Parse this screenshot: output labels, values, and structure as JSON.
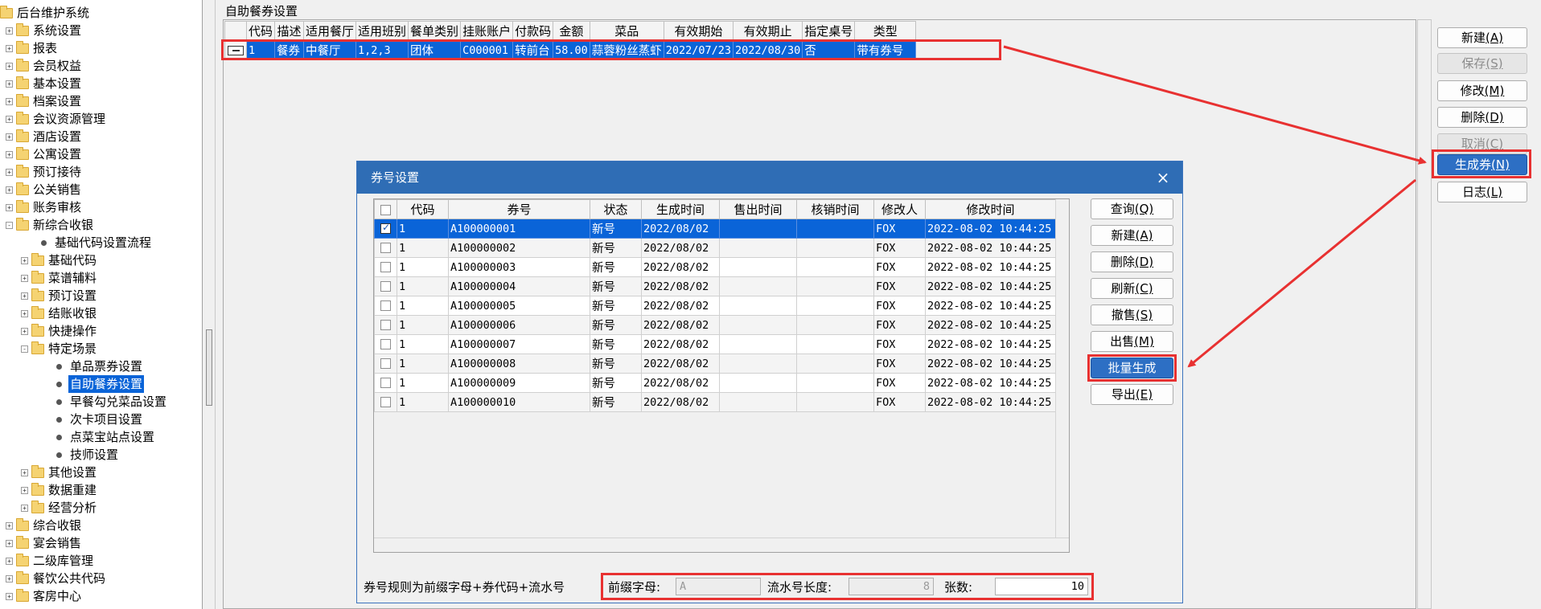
{
  "tree": {
    "items": [
      {
        "label": "后台维护系统",
        "level": 0,
        "kind": "folder",
        "toggle": ""
      },
      {
        "label": "系统设置",
        "level": 1,
        "kind": "folder",
        "toggle": "+"
      },
      {
        "label": "报表",
        "level": 1,
        "kind": "folder",
        "toggle": "+"
      },
      {
        "label": "会员权益",
        "level": 1,
        "kind": "folder",
        "toggle": "+"
      },
      {
        "label": "基本设置",
        "level": 1,
        "kind": "folder",
        "toggle": "+"
      },
      {
        "label": "档案设置",
        "level": 1,
        "kind": "folder",
        "toggle": "+"
      },
      {
        "label": "会议资源管理",
        "level": 1,
        "kind": "folder",
        "toggle": "+"
      },
      {
        "label": "酒店设置",
        "level": 1,
        "kind": "folder",
        "toggle": "+"
      },
      {
        "label": "公寓设置",
        "level": 1,
        "kind": "folder",
        "toggle": "+"
      },
      {
        "label": "预订接待",
        "level": 1,
        "kind": "folder",
        "toggle": "+"
      },
      {
        "label": "公关销售",
        "level": 1,
        "kind": "folder",
        "toggle": "+"
      },
      {
        "label": "账务审核",
        "level": 1,
        "kind": "folder",
        "toggle": "+"
      },
      {
        "label": "新综合收银",
        "level": 1,
        "kind": "folder",
        "toggle": "-"
      },
      {
        "label": "基础代码设置流程",
        "level": 2,
        "kind": "leaf",
        "toggle": ""
      },
      {
        "label": "基础代码",
        "level": 2,
        "kind": "folder",
        "toggle": "+"
      },
      {
        "label": "菜谱辅料",
        "level": 2,
        "kind": "folder",
        "toggle": "+"
      },
      {
        "label": "预订设置",
        "level": 2,
        "kind": "folder",
        "toggle": "+"
      },
      {
        "label": "结账收银",
        "level": 2,
        "kind": "folder",
        "toggle": "+"
      },
      {
        "label": "快捷操作",
        "level": 2,
        "kind": "folder",
        "toggle": "+"
      },
      {
        "label": "特定场景",
        "level": 2,
        "kind": "folder",
        "toggle": "-"
      },
      {
        "label": "单品票券设置",
        "level": 3,
        "kind": "leaf",
        "toggle": ""
      },
      {
        "label": "自助餐券设置",
        "level": 3,
        "kind": "leaf",
        "toggle": "",
        "selected": true
      },
      {
        "label": "早餐勾兑菜品设置",
        "level": 3,
        "kind": "leaf",
        "toggle": ""
      },
      {
        "label": "次卡项目设置",
        "level": 3,
        "kind": "leaf",
        "toggle": ""
      },
      {
        "label": "点菜宝站点设置",
        "level": 3,
        "kind": "leaf",
        "toggle": ""
      },
      {
        "label": "技师设置",
        "level": 3,
        "kind": "leaf",
        "toggle": ""
      },
      {
        "label": "其他设置",
        "level": 2,
        "kind": "folder",
        "toggle": "+"
      },
      {
        "label": "数据重建",
        "level": 2,
        "kind": "folder",
        "toggle": "+"
      },
      {
        "label": "经营分析",
        "level": 2,
        "kind": "folder",
        "toggle": "+"
      },
      {
        "label": "综合收银",
        "level": 1,
        "kind": "folder",
        "toggle": "+"
      },
      {
        "label": "宴会销售",
        "level": 1,
        "kind": "folder",
        "toggle": "+"
      },
      {
        "label": "二级库管理",
        "level": 1,
        "kind": "folder",
        "toggle": "+"
      },
      {
        "label": "餐饮公共代码",
        "level": 1,
        "kind": "folder",
        "toggle": "+"
      },
      {
        "label": "客房中心",
        "level": 1,
        "kind": "folder",
        "toggle": "+"
      }
    ]
  },
  "main": {
    "title": "自助餐券设置",
    "columns": [
      "代码",
      "描述",
      "适用餐厅",
      "适用班别",
      "餐单类别",
      "挂账账户",
      "付款码",
      "金额",
      "菜品",
      "有效期始",
      "有效期止",
      "指定桌号",
      "类型"
    ],
    "rows": [
      [
        "1",
        "餐券",
        "中餐厅",
        "1,2,3",
        "团体",
        "C000001",
        "转前台",
        "58.00",
        "蒜蓉粉丝蒸虾",
        "2022/07/23",
        "2022/08/30",
        "否",
        "带有券号"
      ]
    ]
  },
  "side_buttons": [
    {
      "label": "新建",
      "key": "(A)",
      "state": "normal"
    },
    {
      "label": "保存",
      "key": "(S)",
      "state": "disabled"
    },
    {
      "label": "修改",
      "key": "(M)",
      "state": "normal"
    },
    {
      "label": "删除",
      "key": "(D)",
      "state": "normal"
    },
    {
      "label": "取消",
      "key": "(C)",
      "state": "disabled"
    },
    {
      "label": "生成券",
      "key": "(N)",
      "state": "active"
    },
    {
      "label": "日志",
      "key": "(L)",
      "state": "normal"
    }
  ],
  "dialog": {
    "title": "券号设置",
    "close": "×",
    "columns": [
      "",
      "代码",
      "券号",
      "状态",
      "生成时间",
      "售出时间",
      "核销时间",
      "修改人",
      "修改时间"
    ],
    "rows": [
      {
        "checked": true,
        "cells": [
          "1",
          "A100000001",
          "新号",
          "2022/08/02",
          "",
          "",
          "FOX",
          "2022-08-02 10:44:25"
        ]
      },
      {
        "checked": false,
        "cells": [
          "1",
          "A100000002",
          "新号",
          "2022/08/02",
          "",
          "",
          "FOX",
          "2022-08-02 10:44:25"
        ]
      },
      {
        "checked": false,
        "cells": [
          "1",
          "A100000003",
          "新号",
          "2022/08/02",
          "",
          "",
          "FOX",
          "2022-08-02 10:44:25"
        ]
      },
      {
        "checked": false,
        "cells": [
          "1",
          "A100000004",
          "新号",
          "2022/08/02",
          "",
          "",
          "FOX",
          "2022-08-02 10:44:25"
        ]
      },
      {
        "checked": false,
        "cells": [
          "1",
          "A100000005",
          "新号",
          "2022/08/02",
          "",
          "",
          "FOX",
          "2022-08-02 10:44:25"
        ]
      },
      {
        "checked": false,
        "cells": [
          "1",
          "A100000006",
          "新号",
          "2022/08/02",
          "",
          "",
          "FOX",
          "2022-08-02 10:44:25"
        ]
      },
      {
        "checked": false,
        "cells": [
          "1",
          "A100000007",
          "新号",
          "2022/08/02",
          "",
          "",
          "FOX",
          "2022-08-02 10:44:25"
        ]
      },
      {
        "checked": false,
        "cells": [
          "1",
          "A100000008",
          "新号",
          "2022/08/02",
          "",
          "",
          "FOX",
          "2022-08-02 10:44:25"
        ]
      },
      {
        "checked": false,
        "cells": [
          "1",
          "A100000009",
          "新号",
          "2022/08/02",
          "",
          "",
          "FOX",
          "2022-08-02 10:44:25"
        ]
      },
      {
        "checked": false,
        "cells": [
          "1",
          "A100000010",
          "新号",
          "2022/08/02",
          "",
          "",
          "FOX",
          "2022-08-02 10:44:25"
        ]
      }
    ],
    "buttons": [
      {
        "label": "查询",
        "key": "(Q)",
        "state": "normal"
      },
      {
        "label": "新建",
        "key": "(A)",
        "state": "normal"
      },
      {
        "label": "删除",
        "key": "(D)",
        "state": "normal"
      },
      {
        "label": "刷新",
        "key": "(C)",
        "state": "normal"
      },
      {
        "label": "撤售",
        "key": "(S)",
        "state": "normal"
      },
      {
        "label": "出售",
        "key": "(M)",
        "state": "normal"
      },
      {
        "label": "批量生成",
        "key": "",
        "state": "active"
      },
      {
        "label": "导出",
        "key": "(E)",
        "state": "normal"
      }
    ],
    "rule_text": "券号规则为前缀字母+券代码+流水号",
    "prefix_label": "前缀字母:",
    "prefix_value": "A",
    "serial_len_label": "流水号长度:",
    "serial_len_value": "8",
    "count_label": "张数:",
    "count_value": "10"
  },
  "colors": {
    "selection": "#0a64d8",
    "highlight_red": "#e83131",
    "dialog_titlebar": "#2f6db5",
    "active_button": "#2d6fc4"
  }
}
